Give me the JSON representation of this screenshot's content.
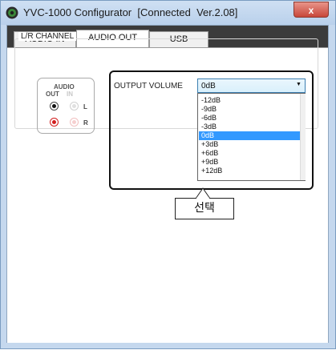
{
  "window": {
    "title": "YVC-1000 Configurator  [Connected  Ver.2.08]",
    "close_label": "x"
  },
  "tabs": [
    {
      "label": "AUDIO IN",
      "active": false
    },
    {
      "label": "AUDIO OUT",
      "active": true
    },
    {
      "label": "USB",
      "active": false
    }
  ],
  "channel_group": {
    "title": "L/R CHANNEL",
    "routing": {
      "header_top": "AUDIO",
      "out_label": "OUT",
      "in_label": "IN",
      "left_label": "L",
      "right_label": "R"
    }
  },
  "output_volume": {
    "label": "OUTPUT VOLUME",
    "selected": "0dB",
    "options": [
      "-12dB",
      "-9dB",
      "-6dB",
      "-3dB",
      "0dB",
      "+3dB",
      "+6dB",
      "+9dB",
      "+12dB"
    ],
    "selected_index": 4
  },
  "annotation": {
    "text": "선택"
  },
  "colors": {
    "titlebar": "#c5d8ee",
    "tabstrip": "#3b3b3b",
    "selection": "#3399ff",
    "right_channel": "#d21e1e",
    "close_button": "#c8473a"
  }
}
